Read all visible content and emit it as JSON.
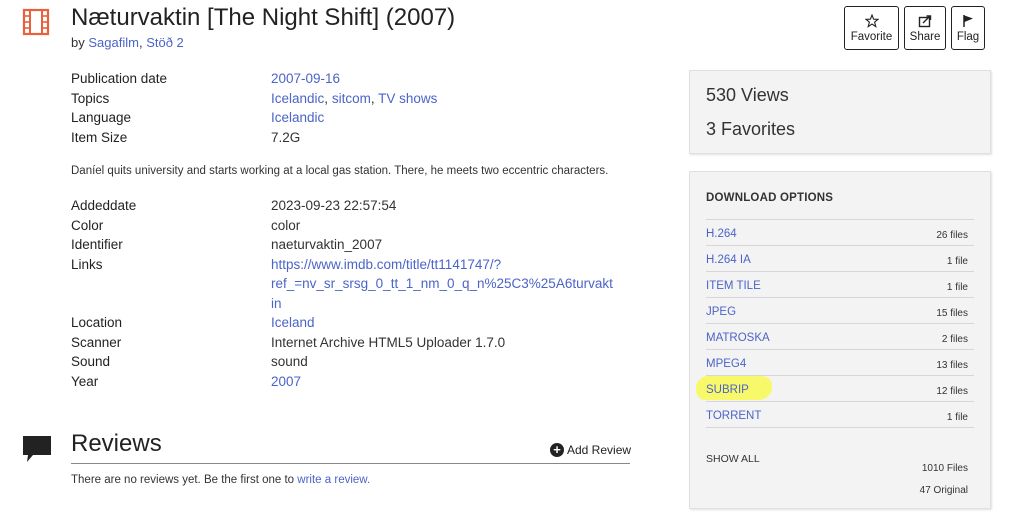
{
  "header": {
    "title": "Næturvaktin [The Night Shift] (2007)",
    "by_prefix": "by",
    "creators": [
      "Sagafilm",
      "Stöð 2"
    ],
    "creator_sep": ","
  },
  "actions": [
    {
      "label": "Favorite",
      "icon": "star-icon"
    },
    {
      "label": "Share",
      "icon": "share-icon"
    },
    {
      "label": "Flag",
      "icon": "flag-icon"
    }
  ],
  "meta_top": [
    {
      "key": "Publication date",
      "value": "2007-09-16",
      "link": true
    },
    {
      "key": "Topics",
      "values": [
        "Icelandic",
        "sitcom",
        "TV shows"
      ],
      "link": true
    },
    {
      "key": "Language",
      "value": "Icelandic",
      "link": true
    },
    {
      "key": "Item Size",
      "value": "7.2G",
      "link": false
    }
  ],
  "description": "Daníel quits university and starts working at a local gas station. There, he meets two eccentric characters.",
  "meta_bottom": [
    {
      "key": "Addeddate",
      "value": "2023-09-23 22:57:54",
      "link": false
    },
    {
      "key": "Color",
      "value": "color",
      "link": false
    },
    {
      "key": "Identifier",
      "value": "naeturvaktin_2007",
      "link": false
    },
    {
      "key": "Links",
      "lines": [
        "https://www.imdb.com/title/tt1141747/?",
        "ref_=nv_sr_srsg_0_tt_1_nm_0_q_n%25C3%25A6turvakt",
        "in"
      ],
      "link": true
    },
    {
      "key": "Location",
      "value": "Iceland",
      "link": true
    },
    {
      "key": "Scanner",
      "value": "Internet Archive HTML5 Uploader 1.7.0",
      "link": false
    },
    {
      "key": "Sound",
      "value": "sound",
      "link": false
    },
    {
      "key": "Year",
      "value": "2007",
      "link": true
    }
  ],
  "reviews": {
    "title": "Reviews",
    "add_label": "Add Review",
    "empty_text": "There are no reviews yet. Be the first one to",
    "empty_link": "write a review."
  },
  "stats": {
    "views": "530 Views",
    "favorites": "3 Favorites"
  },
  "downloads": {
    "title": "DOWNLOAD OPTIONS",
    "items": [
      {
        "format": "H.264",
        "count": "26 files"
      },
      {
        "format": "H.264 IA",
        "count": "1 file"
      },
      {
        "format": "ITEM TILE",
        "count": "1 file"
      },
      {
        "format": "JPEG",
        "count": "15 files"
      },
      {
        "format": "MATROSKA",
        "count": "2 files"
      },
      {
        "format": "MPEG4",
        "count": "13 files"
      },
      {
        "format": "SUBRIP",
        "count": "12 files",
        "highlighted": true
      },
      {
        "format": "TORRENT",
        "count": "1 file"
      }
    ],
    "show_all": "SHOW ALL",
    "total_files": "1010 Files",
    "total_original": "47 Original"
  },
  "colors": {
    "link": "#4b64c8",
    "highlight": "#f8f96a",
    "film_icon": "#e8603c"
  }
}
